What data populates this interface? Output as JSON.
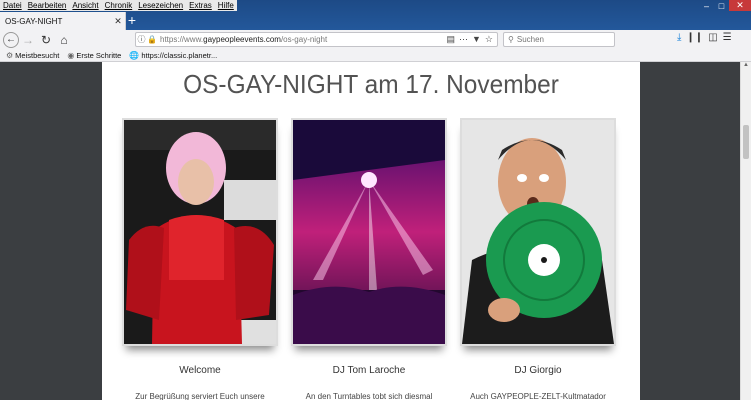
{
  "menubar": {
    "items": [
      "Datei",
      "Bearbeiten",
      "Ansicht",
      "Chronik",
      "Lesezeichen",
      "Extras",
      "Hilfe"
    ]
  },
  "tab": {
    "title": "OS-GAY-NIGHT"
  },
  "nav": {
    "url_prefix": "https://www.",
    "url_domain": "gaypeopleevents.com",
    "url_path": "/os-gay-night",
    "search_placeholder": "Suchen"
  },
  "bookmarks": {
    "items": [
      "Meistbesucht",
      "Erste Schritte",
      "https://classic.planetr..."
    ]
  },
  "page": {
    "headline": "OS-GAY-NIGHT am 17. November",
    "cards": [
      {
        "caption": "Welcome",
        "description": "Zur Begrüßung serviert Euch unsere"
      },
      {
        "caption": "DJ Tom Laroche",
        "description": "An den Turntables tobt sich diesmal"
      },
      {
        "caption": "DJ Giorgio",
        "description": "Auch GAYPEOPLE-ZELT-Kultmatador"
      }
    ]
  },
  "colors": {
    "titlebar": "#23589b",
    "page_bg": "#3b3e41",
    "headline": "#535353",
    "secure_lock": "#2f9a2f"
  }
}
